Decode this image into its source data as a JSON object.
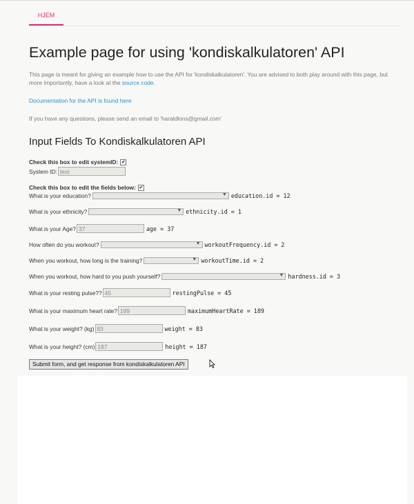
{
  "nav": {
    "tab_home": "HJEM"
  },
  "page_title": "Example page for using 'kondiskalkulatoren' API",
  "intro": {
    "text": "This page is meant for giving an example how to use the API for 'kondiskalkulatoren'. You are advised to both play around with this page, but more importantly, have a look at the ",
    "source_link": "source code",
    "after": "."
  },
  "docs_link": "Documentation for the API is found here",
  "contact": "If you have any questions, please send an email to 'haraldlons@gmail.com'",
  "section_title": "Input Fields To Kondiskalkulatoren API",
  "system_id": {
    "check_label": "Check this box to edit systemID:",
    "checked": true,
    "label": "System ID:",
    "value": "test"
  },
  "edit_fields": {
    "check_label": "Check this box to edit the fields below:",
    "checked": true
  },
  "fields": {
    "education": {
      "label": "What is your education?",
      "readout": "education.id = 12"
    },
    "ethnicity": {
      "label": "What is your ethnicity?",
      "readout": "ethnicity.id = 1"
    },
    "age": {
      "label": "What is your Age?",
      "value": "37",
      "readout": "age = 37"
    },
    "workout_frequency": {
      "label": "How often do you workout?",
      "readout": "workoutFrequency.id = 2"
    },
    "workout_time": {
      "label": "When you workout, how long is the training?",
      "readout": "workoutTime.id = 2"
    },
    "hardness": {
      "label": "When you workout, how hard to you push yourself?",
      "readout": "hardness.id = 3"
    },
    "resting_pulse": {
      "label": "What is your resting pulse??",
      "value": "45",
      "readout": "restingPulse = 45"
    },
    "max_heart_rate": {
      "label": "What is your maximum heart rate?",
      "value": "189",
      "readout": "maximumHeartRate = 189"
    },
    "weight": {
      "label": "What is your weight? (kg)",
      "value": "83",
      "readout": "weight = 83"
    },
    "height": {
      "label": "What is your height? (cm)",
      "value": "187",
      "readout": "height = 187"
    }
  },
  "submit_label": "Submit form, and get response from kondiskalkulatoren API",
  "checkmark": "✔",
  "arrow": "▼"
}
